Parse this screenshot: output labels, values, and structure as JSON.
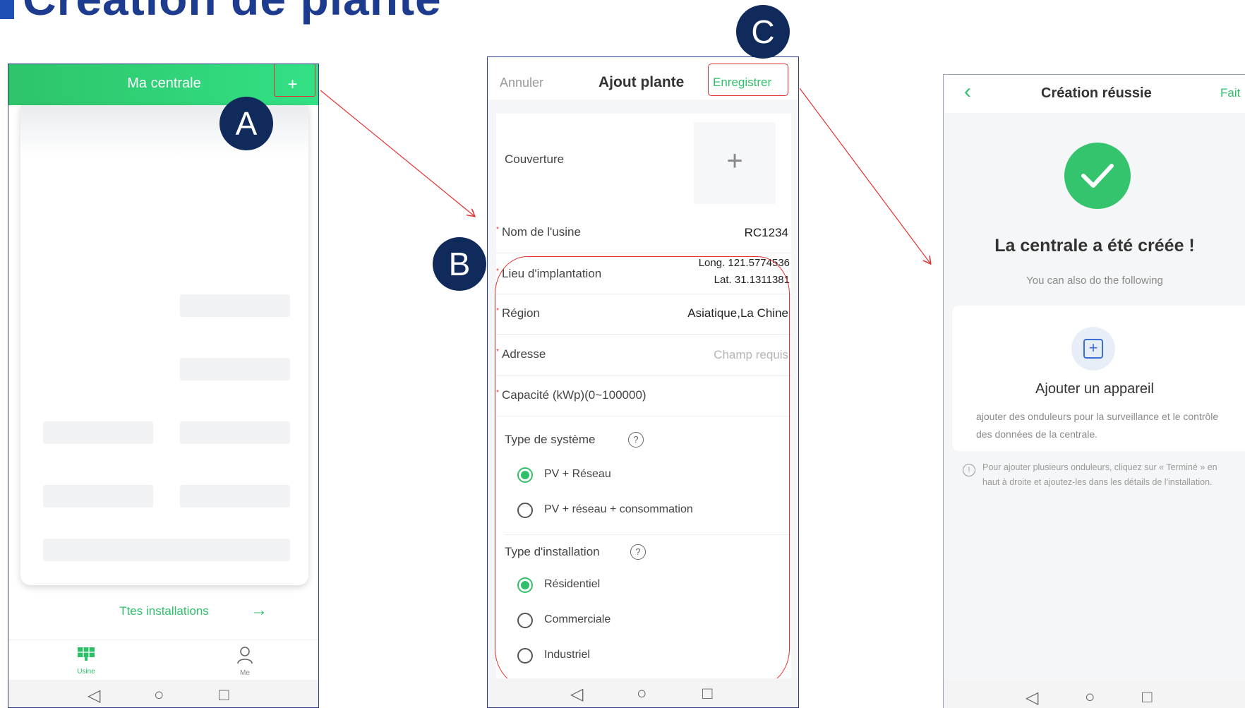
{
  "page": {
    "title": "Création de plante"
  },
  "markers": [
    "A",
    "B",
    "C"
  ],
  "colors": {
    "green": "#2fbf6a",
    "red_annotation": "#e53030",
    "marker": "#102a5c",
    "title": "#1e3c8f"
  },
  "phone1": {
    "header_title": "Ma centrale",
    "add_button": "+",
    "all_installations_link": "Ttes installations",
    "tabs": [
      {
        "label": "Usine",
        "icon": "solar-panel-icon",
        "active": true
      },
      {
        "label": "Me",
        "icon": "person-icon",
        "active": false
      }
    ],
    "system_buttons": [
      "back-icon",
      "home-icon",
      "recents-icon"
    ]
  },
  "phone2": {
    "cancel": "Annuler",
    "title": "Ajout plante",
    "save": "Enregistrer",
    "cover_label": "Couverture",
    "fields": [
      {
        "label": "Nom de l'usine",
        "value": "RC1234",
        "required": true
      },
      {
        "label": "Lieu d'implantation",
        "value_line1": "Long. 121.5774536",
        "value_line2": "Lat. 31.1311381",
        "required": true
      },
      {
        "label": "Région",
        "value": "Asiatique,La Chine",
        "required": true
      },
      {
        "label": "Adresse",
        "placeholder": "Champ requis",
        "required": true
      },
      {
        "label": "Capacité (kWp)(0~100000)",
        "value": "",
        "required": true
      }
    ],
    "system_type": {
      "label": "Type de système",
      "options": [
        "PV + Réseau",
        "PV + réseau + consommation"
      ],
      "selected": "PV + Réseau"
    },
    "installation_type": {
      "label": "Type d'installation",
      "options": [
        "Résidentiel",
        "Commerciale",
        "Industriel"
      ],
      "selected": "Résidentiel"
    }
  },
  "phone3": {
    "title": "Création réussie",
    "done": "Fait",
    "headline": "La centrale a été créée !",
    "subtitle": "You can also do the following",
    "card_title": "Ajouter un appareil",
    "card_desc": "ajouter des onduleurs pour la surveillance et le contrôle des données de la centrale.",
    "note": "Pour ajouter plusieurs onduleurs, cliquez sur « Terminé » en haut à droite et ajoutez-les dans les détails de l'installation."
  }
}
